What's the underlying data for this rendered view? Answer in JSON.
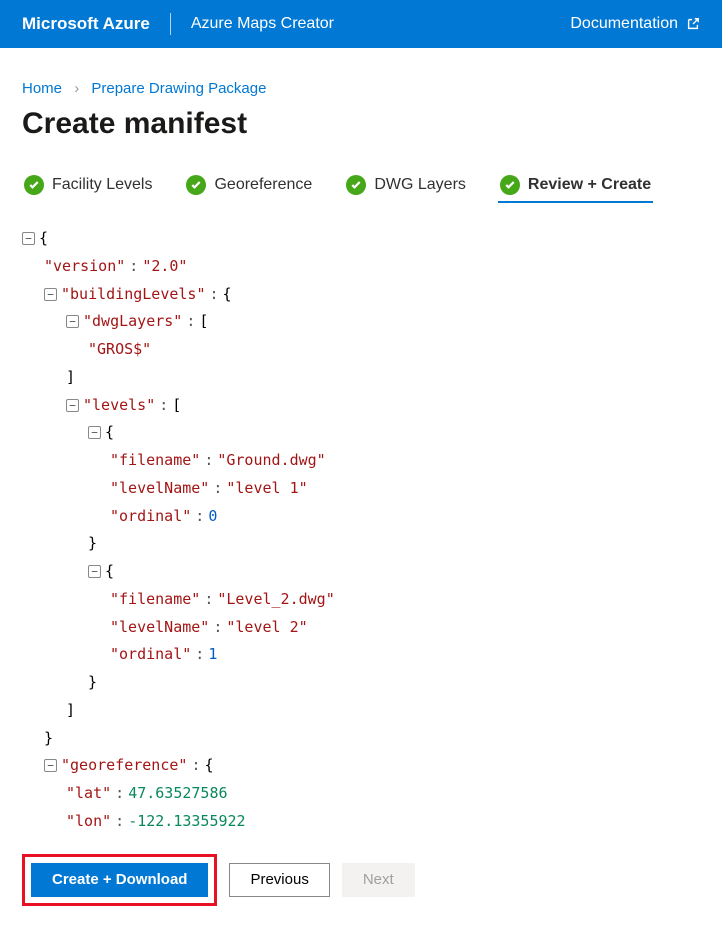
{
  "header": {
    "brand": "Microsoft Azure",
    "product": "Azure Maps Creator",
    "docLabel": "Documentation"
  },
  "breadcrumb": {
    "home": "Home",
    "pkg": "Prepare Drawing Package"
  },
  "pageTitle": "Create manifest",
  "steps": {
    "s1": "Facility Levels",
    "s2": "Georeference",
    "s3": "DWG Layers",
    "s4": "Review + Create"
  },
  "manifest": {
    "versionKey": "\"version\"",
    "versionVal": "\"2.0\"",
    "buildingLevelsKey": "\"buildingLevels\"",
    "dwgLayersKey": "\"dwgLayers\"",
    "dwgLayer0": "\"GROS$\"",
    "levelsKey": "\"levels\"",
    "filenameKey": "\"filename\"",
    "levelNameKey": "\"levelName\"",
    "ordinalKey": "\"ordinal\"",
    "l0_filename": "\"Ground.dwg\"",
    "l0_levelName": "\"level 1\"",
    "l0_ordinal": "0",
    "l1_filename": "\"Level_2.dwg\"",
    "l1_levelName": "\"level 2\"",
    "l1_ordinal": "1",
    "georeferenceKey": "\"georeference\"",
    "latKey": "\"lat\"",
    "latVal": "47.63527586",
    "lonKey": "\"lon\"",
    "lonVal": "-122.13355922"
  },
  "buttons": {
    "create": "Create + Download",
    "prev": "Previous",
    "next": "Next"
  }
}
